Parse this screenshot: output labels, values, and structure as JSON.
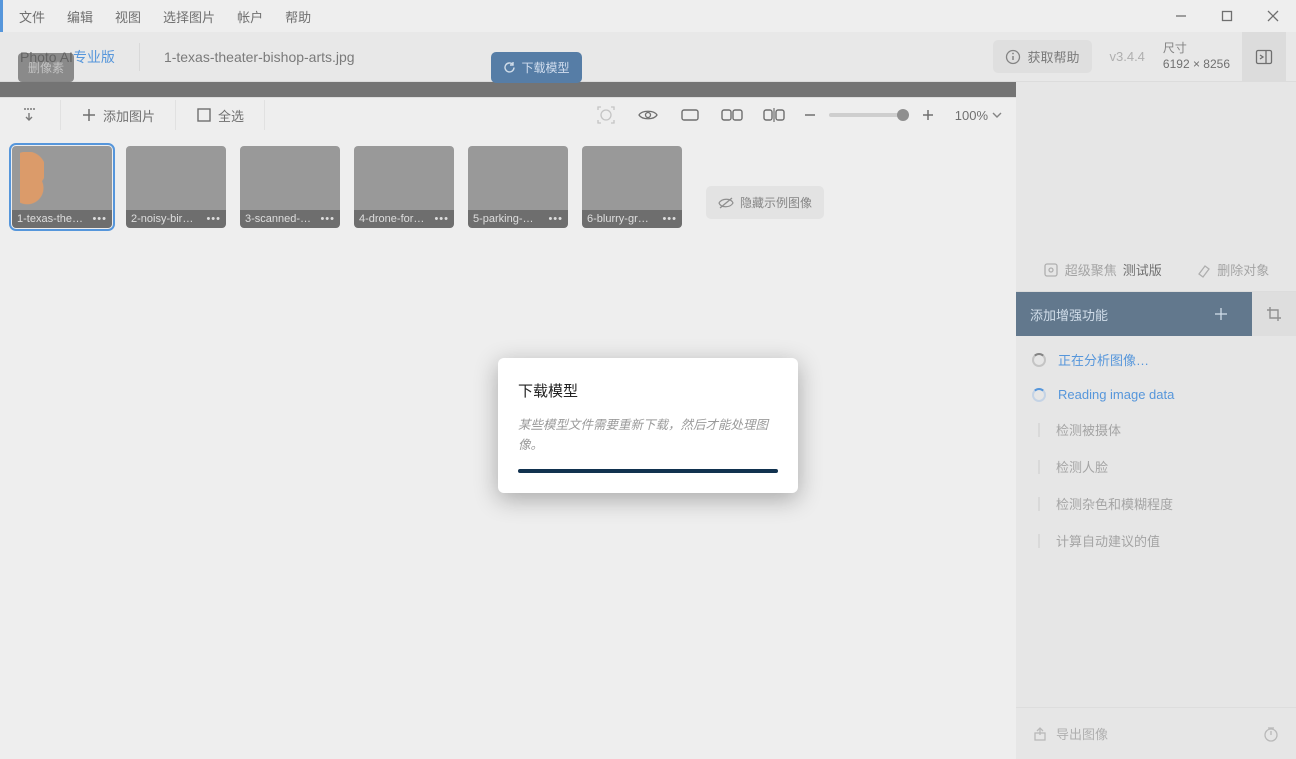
{
  "menu": {
    "items": [
      "文件",
      "编辑",
      "视图",
      "选择图片",
      "帐户",
      "帮助"
    ]
  },
  "header": {
    "logo_main": "Photo AI",
    "logo_pro": "专业版",
    "filename": "1-texas-theater-bishop-arts.jpg",
    "help_label": "获取帮助",
    "version": "v3.4.4",
    "size_label": "尺寸",
    "size_value": "6192 × 8256"
  },
  "canvas_actions": {
    "remove_pixel": "删像素",
    "download_model": "下载模型"
  },
  "toolbar": {
    "add_images": "添加图片",
    "select_all": "全选",
    "zoom_value": "100%"
  },
  "thumbnails": [
    {
      "label": "1-texas-the…"
    },
    {
      "label": "2-noisy-bir…"
    },
    {
      "label": "3-scanned-…"
    },
    {
      "label": "4-drone-for…"
    },
    {
      "label": "5-parking-…"
    },
    {
      "label": "6-blurry-gr…"
    }
  ],
  "hide_samples": "隐藏示例图像",
  "sidebar": {
    "tab_superfocus": "超级聚焦",
    "tab_superfocus_badge": "测试版",
    "tab_remove": "删除对象",
    "add_enhance": "添加增强功能",
    "steps_header": "正在分析图像…",
    "steps": [
      "Reading image data",
      "检测被摄体",
      "检测人脸",
      "检测杂色和模糊程度",
      "计算自动建议的值"
    ],
    "export": "导出图像"
  },
  "modal": {
    "title": "下载模型",
    "message": "某些模型文件需要重新下载，然后才能处理图像。"
  }
}
